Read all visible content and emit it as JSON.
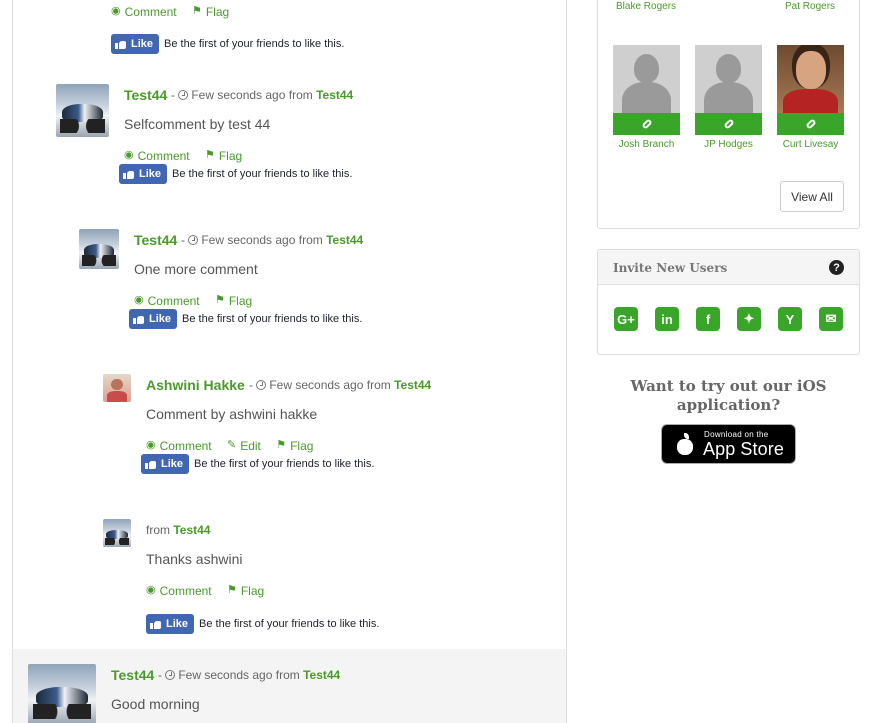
{
  "thread": {
    "comments": [
      {
        "actions": {
          "comment": "Comment",
          "flag": "Flag"
        },
        "fb": {
          "button": "Like",
          "text": "Be the first of your friends to like this."
        }
      },
      {
        "author": "Test44",
        "sep": " - ",
        "time": "Few seconds ago",
        "from": "from",
        "source": "Test44",
        "text": "Selfcomment by test 44",
        "actions": {
          "comment": "Comment",
          "flag": "Flag"
        },
        "fb": {
          "button": "Like",
          "text": "Be the first of your friends to like this."
        }
      },
      {
        "author": "Test44",
        "sep": " - ",
        "time": "Few seconds ago",
        "from": "from",
        "source": "Test44",
        "text": "One more comment",
        "actions": {
          "comment": "Comment",
          "flag": "Flag"
        },
        "fb": {
          "button": "Like",
          "text": "Be the first of your friends to like this."
        }
      },
      {
        "author": "Ashwini Hakke",
        "sep": " - ",
        "time": "Few seconds ago",
        "from": "from",
        "source": "Test44",
        "text": "Comment by ashwini hakke",
        "actions": {
          "comment": "Comment",
          "edit": "Edit",
          "flag": "Flag"
        },
        "fb": {
          "button": "Like",
          "text": "Be the first of your friends to like this."
        }
      },
      {
        "from": "from",
        "source": "Test44",
        "text": "Thanks ashwini",
        "actions": {
          "comment": "Comment",
          "flag": "Flag"
        },
        "fb": {
          "button": "Like",
          "text": "Be the first of your friends to like this."
        }
      },
      {
        "author": "Test44",
        "sep": " - ",
        "time": "Few seconds ago",
        "from": "from",
        "source": "Test44",
        "text": "Good morning"
      }
    ]
  },
  "sidebar": {
    "friends_top": [
      "Blake Rogers",
      "Pat Rogers"
    ],
    "friends": [
      {
        "name": "Josh Branch"
      },
      {
        "name": "JP Hodges"
      },
      {
        "name": "Curt Livesay"
      }
    ],
    "view_all": "View All",
    "invite": {
      "title": "Invite New Users",
      "help": "?",
      "icons": [
        "google-plus-icon",
        "linkedin-icon",
        "facebook-icon",
        "twitter-icon",
        "ycombinator-icon",
        "email-icon"
      ]
    },
    "ios": {
      "line1": "Want to try out our iOS",
      "line2": "application?",
      "badge_small": "Download on the",
      "badge_big": "App Store"
    }
  },
  "colors": {
    "accent": "#4a9a2c",
    "green_button": "#3aa629",
    "facebook": "#4267b2"
  }
}
